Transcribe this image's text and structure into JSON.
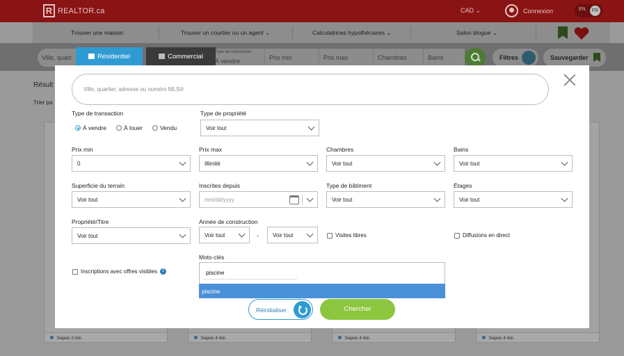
{
  "header": {
    "logo_text": "REALTOR.ca",
    "currency": "CAD",
    "login": "Connexion",
    "lang_en": "EN",
    "lang_fr": "FR"
  },
  "nav": {
    "items": [
      "Trouver une maison",
      "Trouver un courtier ou un agent",
      "Calculatrices hypothécaires",
      "Salon blogue"
    ]
  },
  "searchbar": {
    "city_placeholder": "Ville, quart",
    "type_label": "Type de transaction",
    "type_value": "À vendre",
    "price_min": "Prix min",
    "price_max": "Prix max",
    "bedrooms": "Chambres",
    "baths": "Bains",
    "filters": "Filtres",
    "save": "Sauvegarder"
  },
  "tabs": {
    "residential": "Résidentiel",
    "commercial": "Commercial"
  },
  "background": {
    "results": "Résult",
    "sort": "Trier pa",
    "card_footers": [
      "Depuis 2 min",
      "Depuis 4 min",
      "Depuis 4 min",
      "Depuis 4 min"
    ]
  },
  "modal": {
    "search_placeholder": "Ville, quartier, adresse ou numéro MLS®",
    "transaction": {
      "label": "Type de transaction",
      "options": [
        "À vendre",
        "À louer",
        "Vendu"
      ],
      "selected": "À vendre"
    },
    "property_type": {
      "label": "Type de propriété",
      "value": "Voir tout"
    },
    "price_min": {
      "label": "Prix min",
      "value": "0"
    },
    "price_max": {
      "label": "Prix max",
      "value": "Illimité"
    },
    "bedrooms": {
      "label": "Chambres",
      "value": "Voir tout"
    },
    "baths": {
      "label": "Bains",
      "value": "Voir tout"
    },
    "land_size": {
      "label": "Superficie du terrain",
      "value": "Voir tout"
    },
    "listed_since": {
      "label": "Inscrites depuis",
      "placeholder": "mm/dd/yyyy"
    },
    "building_type": {
      "label": "Type de bâtiment",
      "value": "Voir tout"
    },
    "storeys": {
      "label": "Étages",
      "value": "Voir tout"
    },
    "ownership": {
      "label": "Propriété/Titre",
      "value": "Voir tout"
    },
    "year_built": {
      "label": "Année de construction",
      "from": "Voir tout",
      "to": "Voir tout",
      "dash": "-"
    },
    "open_house": "Visites libres",
    "live_stream": "Diffusions en direct",
    "visible_offers": "Inscriptions avec offres visibles",
    "keywords": {
      "label": "Mots-clés",
      "value": "piscine",
      "suggestion": "piscine"
    },
    "reset": "Réinitialiser",
    "search": "Chercher"
  }
}
